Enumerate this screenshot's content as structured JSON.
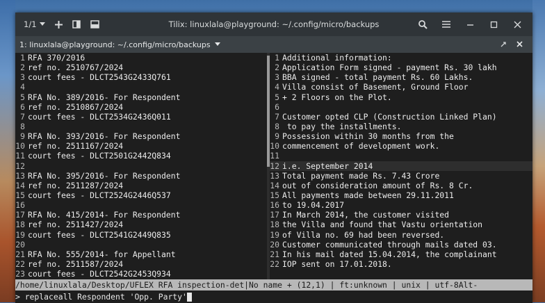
{
  "window": {
    "title": "Tilix: linuxlala@playground: ~/.config/micro/backups",
    "session_label": "1/1"
  },
  "tab": {
    "title": "1: linuxlala@playground: ~/.config/micro/backups"
  },
  "left_pane": {
    "lines": [
      {
        "n": "1",
        "text": "RFA 370/2016"
      },
      {
        "n": "2",
        "text": "ref no. 2510767/2024"
      },
      {
        "n": "3",
        "text": "court fees - DLCT2543G2433Q761"
      },
      {
        "n": "4",
        "text": ""
      },
      {
        "n": "5",
        "text": "RFA No. 389/2016- For Respondent"
      },
      {
        "n": "6",
        "text": "ref no. 2510867/2024"
      },
      {
        "n": "7",
        "text": "court fees - DLCT2534G2436Q011"
      },
      {
        "n": "8",
        "text": ""
      },
      {
        "n": "9",
        "text": "RFA No. 393/2016- For Respondent"
      },
      {
        "n": "10",
        "text": "ref no. 2511167/2024"
      },
      {
        "n": "11",
        "text": "court fees - DLCT2501G2442Q834"
      },
      {
        "n": "12",
        "text": ""
      },
      {
        "n": "13",
        "text": "RFA No. 395/2016- For Respondent"
      },
      {
        "n": "14",
        "text": "ref no. 2511287/2024"
      },
      {
        "n": "15",
        "text": "court fees - DLCT2524G2446Q537"
      },
      {
        "n": "16",
        "text": ""
      },
      {
        "n": "17",
        "text": "RFA No. 415/2014- For Respondent"
      },
      {
        "n": "18",
        "text": "ref no. 2511427/2024"
      },
      {
        "n": "19",
        "text": "court fees - DLCT2541G2449Q835"
      },
      {
        "n": "20",
        "text": ""
      },
      {
        "n": "21",
        "text": "RFA No. 555/2014- for Appellant"
      },
      {
        "n": "22",
        "text": "ref no. 2511587/2024"
      },
      {
        "n": "23",
        "text": "court fees - DLCT2542G2453Q934"
      }
    ]
  },
  "right_pane": {
    "lines": [
      {
        "n": "1",
        "text": "Additional information:"
      },
      {
        "n": "2",
        "text": "Application Form signed - payment Rs. 30 lakh"
      },
      {
        "n": "3",
        "text": "BBA signed - total payment Rs. 60 Lakhs."
      },
      {
        "n": "4",
        "text": "Villa consist of Basement, Ground Floor"
      },
      {
        "n": "5",
        "text": "+ 2 Floors on the Plot."
      },
      {
        "n": "6",
        "text": ""
      },
      {
        "n": "7",
        "text": "Customer opted CLP (Construction Linked Plan)"
      },
      {
        "n": "8",
        "text": " to pay the installments."
      },
      {
        "n": "9",
        "text": "Possession within 30 months from the"
      },
      {
        "n": "10",
        "text": "commencement of development work."
      },
      {
        "n": "11",
        "text": ""
      },
      {
        "n": "12",
        "text": "i.e. September 2014"
      },
      {
        "n": "13",
        "text": "Total payment made Rs. 7.43 Crore"
      },
      {
        "n": "14",
        "text": "out of consideration amount of Rs. 8 Cr."
      },
      {
        "n": "15",
        "text": "All payments made between 29.11.2011"
      },
      {
        "n": "16",
        "text": "to 19.04.2017"
      },
      {
        "n": "17",
        "text": "In March 2014, the customer visited"
      },
      {
        "n": "18",
        "text": "the Villa and found that Vastu orientation"
      },
      {
        "n": "19",
        "text": "of Villa no. 69 had been reversed."
      },
      {
        "n": "20",
        "text": "Customer communicated through mails dated 03."
      },
      {
        "n": "21",
        "text": "In his mail dated 15.04.2014, the complainant"
      },
      {
        "n": "22",
        "text": "IOP sent on 17.01.2018."
      }
    ],
    "current_line": "12"
  },
  "statusbar": {
    "text": "/home/linuxlala/Desktop/UFLEX RFA inspection-det|No name + (12,1) | ft:unknown | unix | utf-8Alt-"
  },
  "cmdline": {
    "text": "> replaceall Respondent 'Opp. Party'"
  },
  "colors": {
    "terminal_bg": "#1e1e1e",
    "statusbar_bg": "#b8b8b8",
    "titlebar_bg": "#2f3438"
  },
  "icons": [
    "chevron-down-icon",
    "add-terminal-icon",
    "split-right-icon",
    "split-down-icon",
    "search-icon",
    "hamburger-menu-icon",
    "minimize-icon",
    "maximize-icon",
    "close-icon",
    "resize-icon"
  ]
}
